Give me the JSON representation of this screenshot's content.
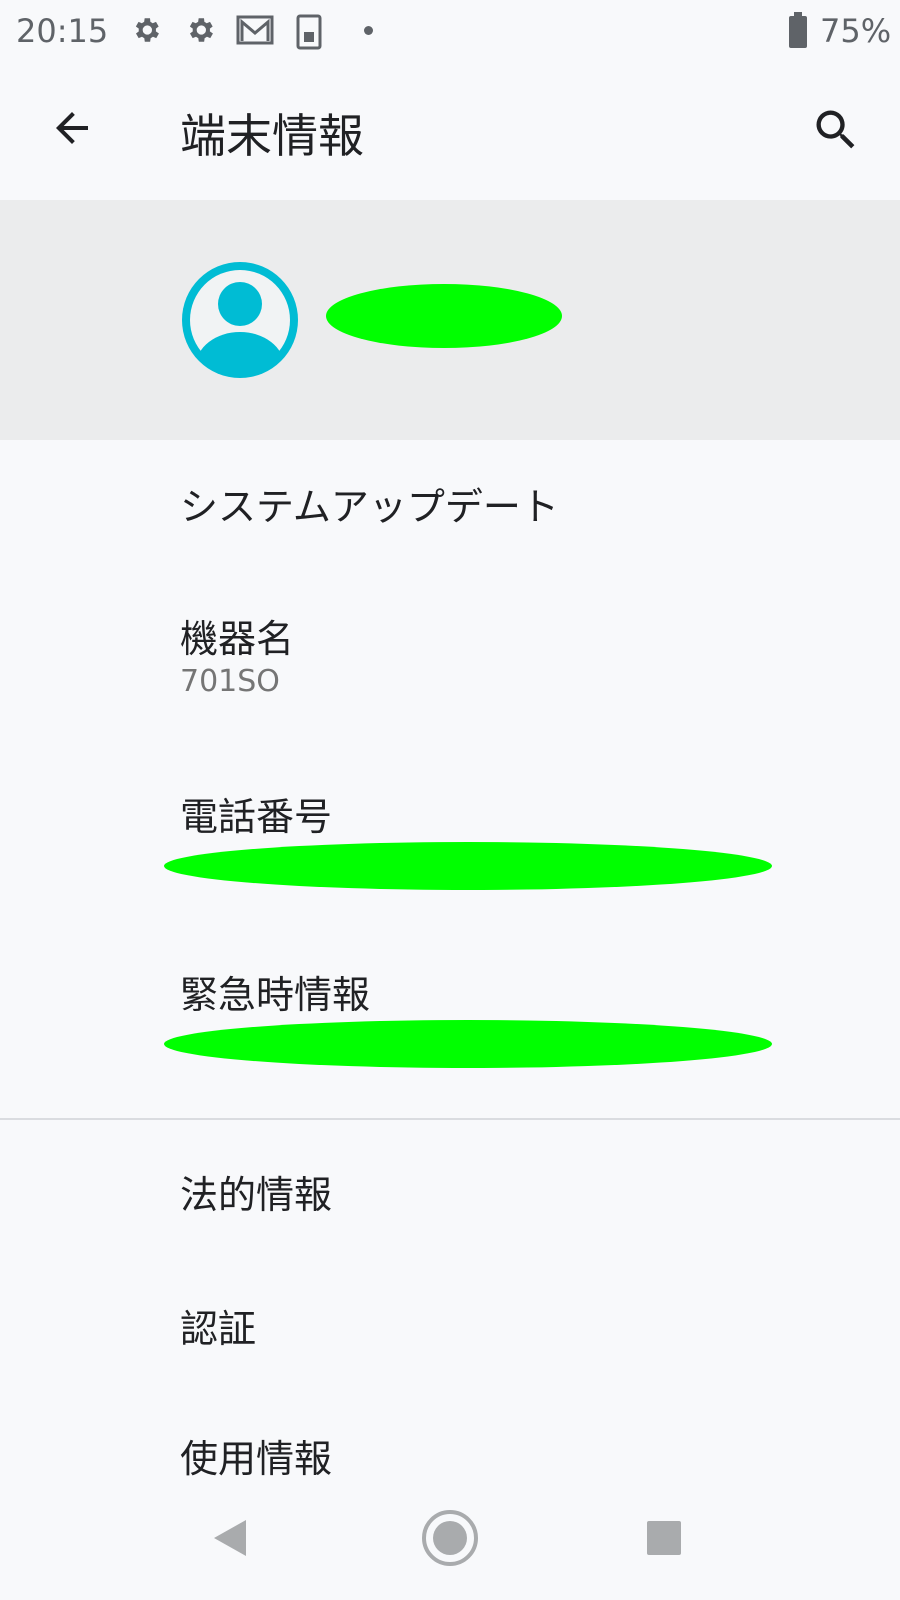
{
  "status_bar": {
    "time": "20:15",
    "icons": [
      "gear-icon",
      "gear-icon",
      "gmail-icon",
      "sim-card-icon",
      "notification-dot"
    ],
    "battery_percent": "75%",
    "battery_level": 0.75
  },
  "app_bar": {
    "title": "端末情報",
    "back_icon": "arrow-back-icon",
    "search_icon": "search-icon"
  },
  "account": {
    "avatar_icon": "account-circle-icon",
    "name": "",
    "accent_color": "#00bcd4"
  },
  "items": [
    {
      "title": "システムアップデート"
    },
    {
      "title": "機器名",
      "summary": "701SO"
    },
    {
      "title": "電話番号"
    },
    {
      "title": "緊急時情報"
    },
    {
      "title": "法的情報"
    },
    {
      "title": "認証"
    },
    {
      "title": "使用情報"
    }
  ],
  "nav_bar": {
    "back": "nav-back-icon",
    "home": "nav-home-icon",
    "recents": "nav-recents-icon"
  },
  "colors": {
    "background": "#f8f9fb",
    "header_background": "#ebeced",
    "redaction": "#00ff00",
    "text_primary": "#202124",
    "text_secondary": "#757575"
  }
}
